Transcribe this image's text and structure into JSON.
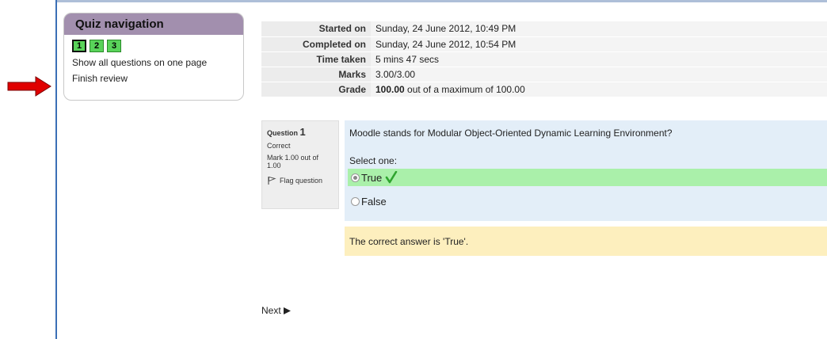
{
  "quiz_nav": {
    "title": "Quiz navigation",
    "questions": [
      "1",
      "2",
      "3"
    ],
    "show_all_label": "Show all questions on one page",
    "finish_review_label": "Finish review"
  },
  "summary": {
    "started_on_label": "Started on",
    "started_on_value": "Sunday, 24 June 2012, 10:49 PM",
    "completed_on_label": "Completed on",
    "completed_on_value": "Sunday, 24 June 2012, 10:54 PM",
    "time_taken_label": "Time taken",
    "time_taken_value": "5 mins 47 secs",
    "marks_label": "Marks",
    "marks_value": "3.00/3.00",
    "grade_label": "Grade",
    "grade_bold": "100.00",
    "grade_rest": " out of a maximum of 100.00"
  },
  "question": {
    "label": "Question",
    "number": "1",
    "state": "Correct",
    "mark": "Mark 1.00 out of 1.00",
    "flag_label": "Flag question",
    "text": "Moodle stands for Modular Object-Oriented Dynamic Learning Environment?",
    "prompt": "Select one:",
    "options": [
      "True",
      "False"
    ],
    "feedback": "The correct answer is 'True'."
  },
  "footer": {
    "next_label": "Next"
  },
  "colors": {
    "nav_header": "#a28fae",
    "question_bg": "#e3eef8",
    "correct_bg": "#aaf0aa",
    "feedback_bg": "#fdefbe",
    "tick": "#2fa52f",
    "arrow": "#e00000"
  }
}
